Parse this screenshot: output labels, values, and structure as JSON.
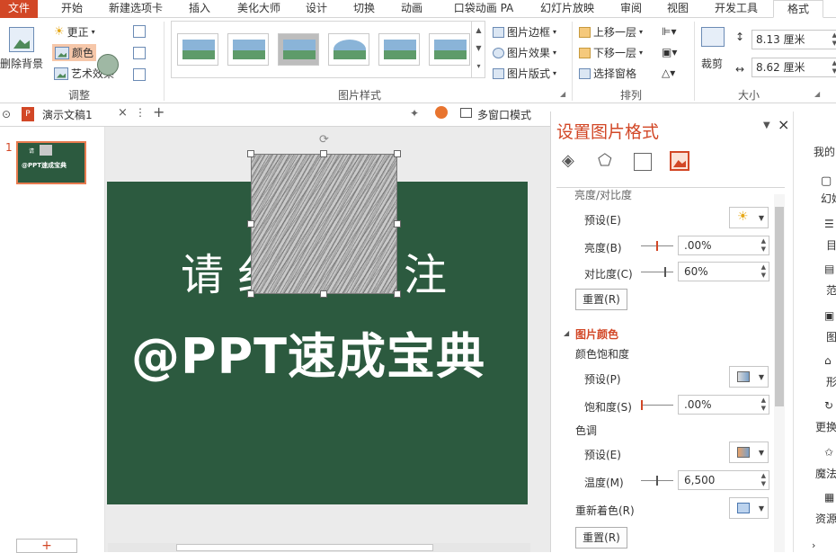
{
  "menu": {
    "file": "文件",
    "tabs": [
      "开始",
      "新建选项卡",
      "插入",
      "美化大师",
      "设计",
      "切换",
      "动画",
      "口袋动画 PA",
      "幻灯片放映",
      "审阅",
      "视图",
      "开发工具",
      "格式"
    ]
  },
  "ribbon": {
    "remove_bg": "删除背景",
    "corrections": "更正",
    "color": "颜色",
    "artistic": "艺术效果",
    "group_adjust": "调整",
    "group_styles": "图片样式",
    "border": "图片边框",
    "effects": "图片效果",
    "layout": "图片版式",
    "bring_forward": "上移一层",
    "send_backward": "下移一层",
    "selection_pane": "选择窗格",
    "group_arrange": "排列",
    "crop": "裁剪",
    "height": "8.13 厘米",
    "width": "8.62 厘米",
    "group_size": "大小"
  },
  "tabbar": {
    "doc_name": "演示文稿1",
    "multiwindow": "多窗口模式"
  },
  "thumbs": {
    "slide_number": "1",
    "thumb_line1": "请",
    "thumb_line2": "@PPT速成宝典",
    "add": "+"
  },
  "slide": {
    "line1_left": "请",
    "line1_partial": "纟",
    "line1_right": "注",
    "line2": "@PPT速成宝典",
    "bg_color": "#2c5a3f"
  },
  "format_pane": {
    "title": "设置图片格式",
    "section_bc": "亮度/对比度",
    "preset": "预设(E)",
    "brightness": "亮度(B)",
    "brightness_val": ".00%",
    "contrast": "对比度(C)",
    "contrast_val": "60%",
    "reset": "重置(R)",
    "section_color": "图片颜色",
    "saturation_head": "颜色饱和度",
    "preset_p": "预设(P)",
    "saturation": "饱和度(S)",
    "saturation_val": ".00%",
    "tone_head": "色调",
    "preset_e": "预设(E)",
    "temperature": "温度(M)",
    "temperature_val": "6,500",
    "recolor": "重新着色(R)",
    "reset2": "重置(R)",
    "accent": "#d24726"
  },
  "right_strip": {
    "items": [
      "我的",
      "幻始",
      "目",
      "范",
      "图",
      "形",
      "更换",
      "魔法",
      "资源"
    ]
  }
}
